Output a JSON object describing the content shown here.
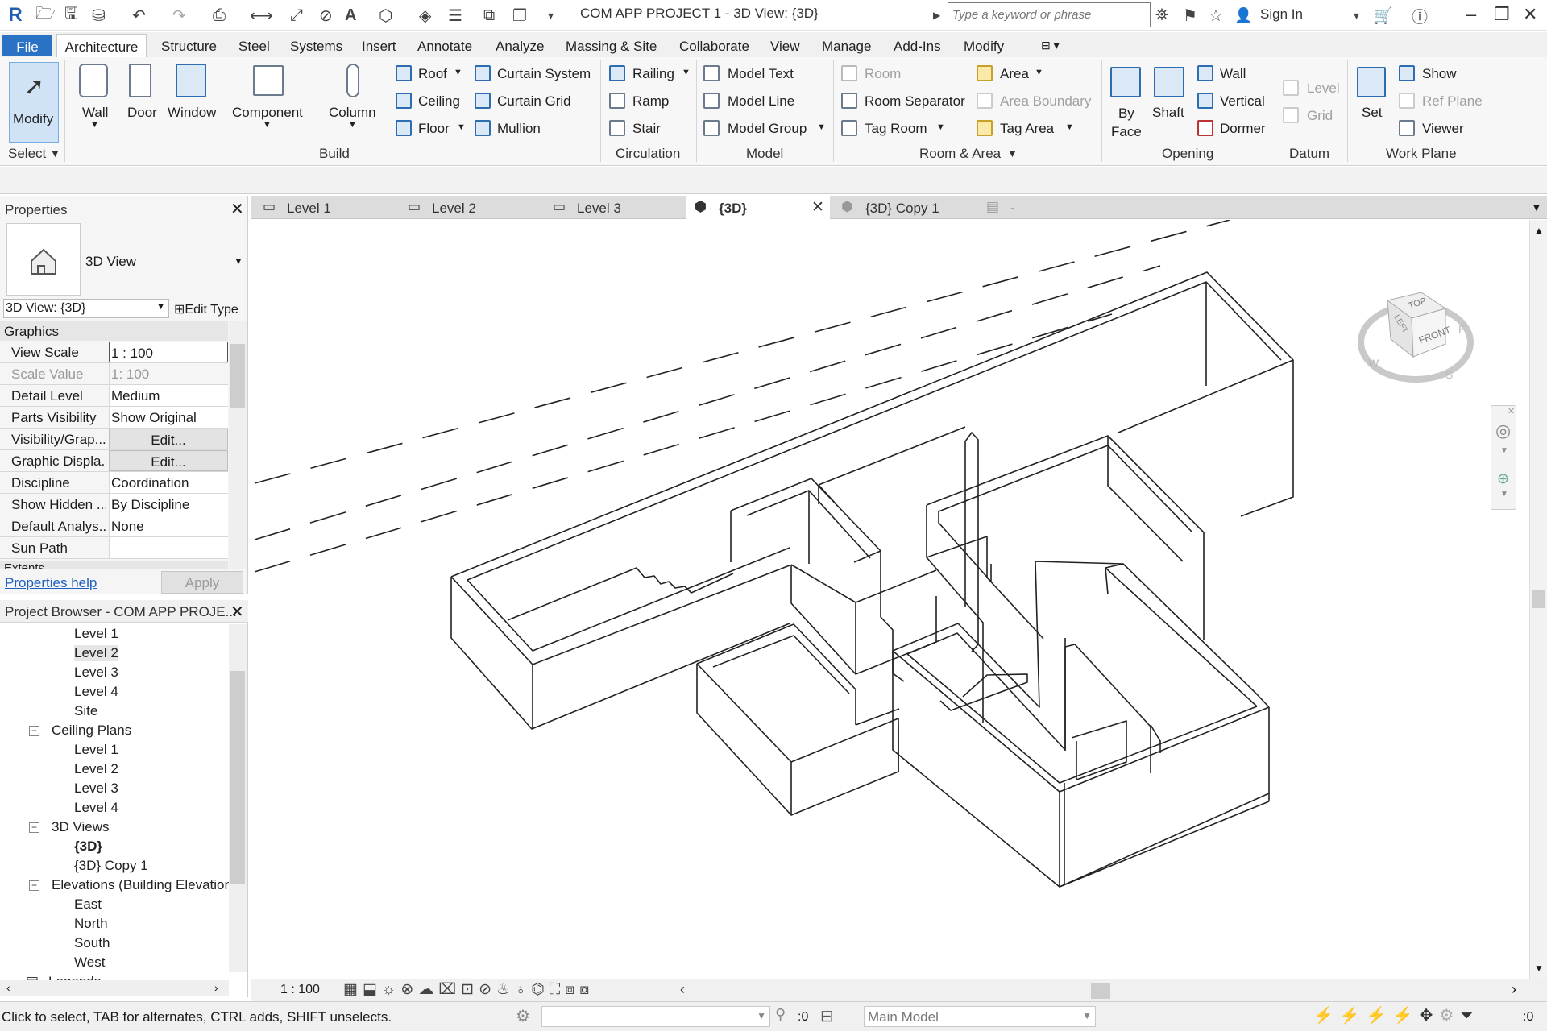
{
  "titlebar": {
    "app_logo": "R",
    "title": "COM APP PROJECT 1 - 3D View: {3D}",
    "search_placeholder": "Type a keyword or phrase",
    "sign_in": "Sign In",
    "icons": [
      "open-icon",
      "save-icon",
      "sync-icon",
      "undo-icon",
      "redo-icon",
      "print-icon",
      "measure-icon",
      "dimension-icon",
      "tag-icon",
      "text-icon",
      "3d-view-icon",
      "section-icon",
      "thin-lines-icon",
      "close-hidden-icon",
      "switch-windows-icon"
    ]
  },
  "ribbon_tabs": [
    "File",
    "Architecture",
    "Structure",
    "Steel",
    "Systems",
    "Insert",
    "Annotate",
    "Analyze",
    "Massing & Site",
    "Collaborate",
    "View",
    "Manage",
    "Add-Ins",
    "Modify"
  ],
  "ribbon": {
    "select": {
      "modify": "Modify",
      "group": "Select"
    },
    "build": {
      "group": "Build",
      "large": [
        "Wall",
        "Door",
        "Window",
        "Component",
        "Column"
      ],
      "col1": [
        "Roof",
        "Ceiling",
        "Floor"
      ],
      "col2": [
        "Curtain  System",
        "Curtain  Grid",
        "Mullion"
      ]
    },
    "circulation": {
      "group": "Circulation",
      "items": [
        "Railing",
        "Ramp",
        "Stair"
      ]
    },
    "model": {
      "group": "Model",
      "items": [
        "Model  Text",
        "Model  Line",
        "Model  Group"
      ]
    },
    "room_area": {
      "group": "Room & Area",
      "col1": [
        "Room",
        "Room  Separator",
        "Tag  Room"
      ],
      "col2": [
        "Area",
        "Area  Boundary",
        "Tag  Area"
      ]
    },
    "opening": {
      "group": "Opening",
      "large": [
        "By\nFace",
        "Shaft"
      ],
      "items": [
        "Wall",
        "Vertical",
        "Dormer"
      ]
    },
    "datum": {
      "group": "Datum",
      "items": [
        "Level",
        "Grid"
      ]
    },
    "work_plane": {
      "group": "Work Plane",
      "set": "Set",
      "items": [
        "Show",
        "Ref  Plane",
        "Viewer"
      ]
    }
  },
  "properties": {
    "title": "Properties",
    "type_name": "3D View",
    "selector": "3D View: {3D}",
    "edit_type": "Edit Type",
    "section": "Graphics",
    "rows": [
      {
        "k": "View Scale",
        "v": "1 : 100"
      },
      {
        "k": "Scale Value",
        "v": "1:  100"
      },
      {
        "k": "Detail Level",
        "v": "Medium"
      },
      {
        "k": "Parts Visibility",
        "v": "Show Original"
      },
      {
        "k": "Visibility/Grap...",
        "v": "Edit..."
      },
      {
        "k": "Graphic Displa...",
        "v": "Edit..."
      },
      {
        "k": "Discipline",
        "v": "Coordination"
      },
      {
        "k": "Show Hidden ...",
        "v": "By Discipline"
      },
      {
        "k": "Default Analys...",
        "v": "None"
      },
      {
        "k": "Sun Path",
        "v": ""
      }
    ],
    "next_section": "Extents",
    "help": "Properties help",
    "apply": "Apply"
  },
  "browser": {
    "title": "Project Browser - COM APP PROJE...",
    "items": [
      {
        "t": "Level 1",
        "lvl": 2
      },
      {
        "t": "Level 2",
        "lvl": 2,
        "sel": true
      },
      {
        "t": "Level 3",
        "lvl": 2
      },
      {
        "t": "Level 4",
        "lvl": 2
      },
      {
        "t": "Site",
        "lvl": 2
      },
      {
        "t": "Ceiling Plans",
        "lvl": 1
      },
      {
        "t": "Level 1",
        "lvl": 2
      },
      {
        "t": "Level 2",
        "lvl": 2
      },
      {
        "t": "Level 3",
        "lvl": 2
      },
      {
        "t": "Level 4",
        "lvl": 2
      },
      {
        "t": "3D Views",
        "lvl": 1
      },
      {
        "t": "{3D}",
        "lvl": 2,
        "bold": true
      },
      {
        "t": "{3D} Copy 1",
        "lvl": 2
      },
      {
        "t": "Elevations (Building Elevation",
        "lvl": 1
      },
      {
        "t": "East",
        "lvl": 2
      },
      {
        "t": "North",
        "lvl": 2
      },
      {
        "t": "South",
        "lvl": 2
      },
      {
        "t": "West",
        "lvl": 2
      },
      {
        "t": "Legends",
        "lvl": 0
      }
    ]
  },
  "view_tabs": [
    {
      "label": "Level 1"
    },
    {
      "label": "Level 2"
    },
    {
      "label": "Level 3"
    },
    {
      "label": "{3D}",
      "active": true
    },
    {
      "label": "{3D} Copy 1"
    },
    {
      "label": "-"
    }
  ],
  "viewcube": {
    "top": "TOP",
    "front": "FRONT",
    "left": "LEFT",
    "w": "W",
    "s": "S",
    "e": "E"
  },
  "viewbar": {
    "scale": "1 : 100"
  },
  "status": {
    "message": "Click to select, TAB for alternates, CTRL adds, SHIFT unselects.",
    "count1": ":0",
    "model": "Main Model",
    "filter": ":0"
  }
}
